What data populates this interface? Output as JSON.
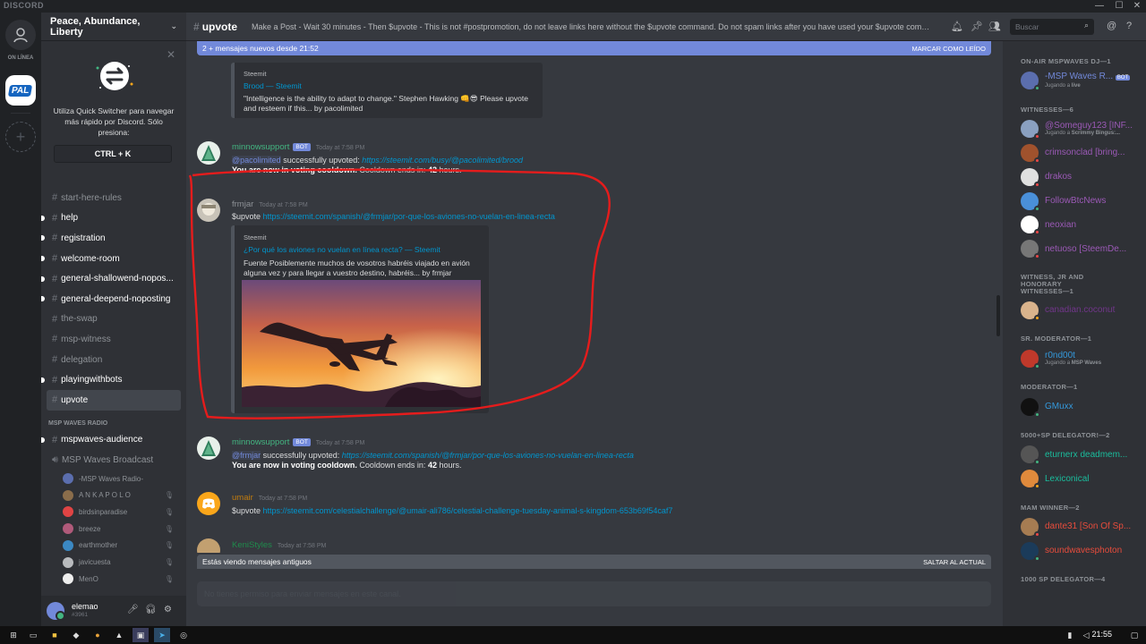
{
  "titlebar": {
    "brand": "DISCORD"
  },
  "guilds": {
    "online_label": "ON LÍNEA",
    "pal_label": "PAL"
  },
  "server": {
    "name": "Peace, Abundance, Liberty"
  },
  "quick_switcher": {
    "text": "Utiliza Quick Switcher para navegar más rápido por Discord. Sólo presiona:",
    "shortcut": "CTRL + K"
  },
  "channels": [
    {
      "name": "start-here-rules",
      "state": "read"
    },
    {
      "name": "help",
      "state": "unread"
    },
    {
      "name": "registration",
      "state": "unread"
    },
    {
      "name": "welcome-room",
      "state": "unread"
    },
    {
      "name": "general-shallowend-nopos...",
      "state": "unread"
    },
    {
      "name": "general-deepend-noposting",
      "state": "unread"
    },
    {
      "name": "the-swap",
      "state": "read"
    },
    {
      "name": "msp-witness",
      "state": "read"
    },
    {
      "name": "delegation",
      "state": "read"
    },
    {
      "name": "playingwithbots",
      "state": "unread"
    },
    {
      "name": "upvote",
      "state": "selected"
    }
  ],
  "radio": {
    "category": "MSP WAVES RADIO",
    "audience_channel": "mspwaves-audience",
    "broadcast_channel": "MSP Waves Broadcast",
    "voice_users": [
      {
        "name": "-MSP Waves Radio-",
        "color": "#5b6eae",
        "muted": false
      },
      {
        "name": "A N K A P O L O",
        "color": "#8a6d4b",
        "muted": true
      },
      {
        "name": "birdsinparadise",
        "color": "#e04444",
        "muted": true
      },
      {
        "name": "breeze",
        "color": "#b05a7a",
        "muted": true
      },
      {
        "name": "earthmother",
        "color": "#3b88c3",
        "muted": true
      },
      {
        "name": "javicuesta",
        "color": "#b9bbbe",
        "muted": true
      },
      {
        "name": "MenO",
        "color": "#eeeeee",
        "muted": true
      }
    ]
  },
  "user": {
    "name": "elemao",
    "tag": "#3961"
  },
  "header": {
    "channel": "upvote",
    "topic": "Make a Post - Wait 30 minutes - Then $upvote - This is not #postpromotion, do not leave links here without the $upvote command. Do not spam links after you have used your $upvote command.",
    "search_placeholder": "Buscar"
  },
  "new_messages_bar": {
    "text": "2 + mensajes nuevos desde 21:52",
    "action": "MARCAR COMO LEÍDO"
  },
  "messages": {
    "embed0": {
      "provider": "Steemit",
      "title": "Brood — Steemit",
      "desc": "\"Intelligence is the ability to adapt to change.\"  Stephen Hawking 👊😎   Please upvote and resteem if this... by pacolimited"
    },
    "m1": {
      "author": "minnowsupport",
      "bot": "BOT",
      "time": "Today at 7:58 PM",
      "mention": "@pacolimited",
      "action": "successfully upvoted:",
      "link": "https://steemit.com/busy/@pacolimited/brood",
      "bold": "You are now in voting cooldown.",
      "rest": "Cooldown ends in:",
      "hours": "42",
      "hours_unit": "hours."
    },
    "m2": {
      "author": "frmjar",
      "time": "Today at 7:58 PM",
      "cmd": "$upvote",
      "link": "https://steemit.com/spanish/@frmjar/por-que-los-aviones-no-vuelan-en-linea-recta",
      "embed": {
        "provider": "Steemit",
        "title": "¿Por qué los aviones no vuelan en línea recta? — Steemit",
        "desc": "Fuente    Posiblemente muchos de  vosotros habréis viajado en avión alguna vez y para llegar a vuestro destino, habréis... by frmjar"
      }
    },
    "m3": {
      "author": "minnowsupport",
      "bot": "BOT",
      "time": "Today at 7:58 PM",
      "mention": "@frmjar",
      "action": "successfully upvoted:",
      "link": "https://steemit.com/spanish/@frmjar/por-que-los-aviones-no-vuelan-en-linea-recta",
      "bold": "You are now in voting cooldown.",
      "rest": "Cooldown ends in:",
      "hours": "42",
      "hours_unit": "hours."
    },
    "m4": {
      "author": "umair",
      "time": "Today at 7:58 PM",
      "cmd": "$upvote",
      "link": "https://steemit.com/celestialchallenge/@umair-ali786/celestial-challenge-tuesday-animal-s-kingdom-653b69f54caf7"
    },
    "m5": {
      "author": "KeniStyles",
      "time": "Today at 7:58 PM"
    }
  },
  "old_bar": {
    "text": "Estás viendo mensajes antiguos",
    "action": "SALTAR AL ACTUAL"
  },
  "input": {
    "placeholder": "No tienes permiso para enviar mensajes en este canal."
  },
  "members": [
    {
      "category": "ON-AIR MSPWAVES DJ—1",
      "items": [
        {
          "name": "-MSP Waves R...",
          "color": "#7289da",
          "bot": "BOT",
          "sub_prefix": "Jugando a ",
          "sub": "live",
          "status": "#43b581",
          "av": "#5b6eae"
        }
      ]
    },
    {
      "category": "WITNESSES—6",
      "items": [
        {
          "name": "@Someguy123 [INF...",
          "color": "#9b59b6",
          "sub_prefix": "Jugando a ",
          "sub": "Scrimmy Bingus:...",
          "status": "#f04747",
          "av": "#8aa0c0"
        },
        {
          "name": "crimsonclad [bring...",
          "color": "#9b59b6",
          "status": "#f04747",
          "av": "#a0522d"
        },
        {
          "name": "drakos",
          "color": "#9b59b6",
          "status": "#f04747",
          "av": "#e0e0e0"
        },
        {
          "name": "FollowBtcNews",
          "color": "#9b59b6",
          "status": "#43b581",
          "av": "#4a90d9"
        },
        {
          "name": "neoxian",
          "color": "#9b59b6",
          "status": "#f04747",
          "av": "#ffffff"
        },
        {
          "name": "netuoso [SteemDe...",
          "color": "#9b59b6",
          "status": "#f04747",
          "av": "#777777"
        }
      ]
    },
    {
      "category": "WITNESS, JR AND HONORARY WITNESSES—1",
      "items": [
        {
          "name": "canadian.coconut",
          "color": "#71368a",
          "status": "#faa61a",
          "av": "#d9b38c"
        }
      ]
    },
    {
      "category": "SR. MODERATOR—1",
      "items": [
        {
          "name": "r0nd00t",
          "color": "#3498db",
          "sub_prefix": "Jugando a ",
          "sub": "MSP Waves",
          "status": "#43b581",
          "av": "#c0392b"
        }
      ]
    },
    {
      "category": "MODERATOR—1",
      "items": [
        {
          "name": "GMuxx",
          "color": "#3498db",
          "status": "#43b581",
          "av": "#111111"
        }
      ]
    },
    {
      "category": "5000+SP DELEGATOR!—2",
      "items": [
        {
          "name": "eturnerx deadmem...",
          "color": "#1abc9c",
          "status": "#43b581",
          "av": "#555555"
        },
        {
          "name": "Lexiconical",
          "color": "#1abc9c",
          "status": "#faa61a",
          "av": "#e08a3c"
        }
      ]
    },
    {
      "category": "MAM WINNER—2",
      "items": [
        {
          "name": "dante31 [Son Of Sp...",
          "color": "#e74c3c",
          "status": "#f04747",
          "av": "#a67c52"
        },
        {
          "name": "soundwavesphoton",
          "color": "#e74c3c",
          "status": "#43b581",
          "av": "#1b3b5a"
        }
      ]
    },
    {
      "category": "1000 SP DELEGATOR—4",
      "items": []
    }
  ],
  "taskbar": {
    "clock": "21:55"
  }
}
